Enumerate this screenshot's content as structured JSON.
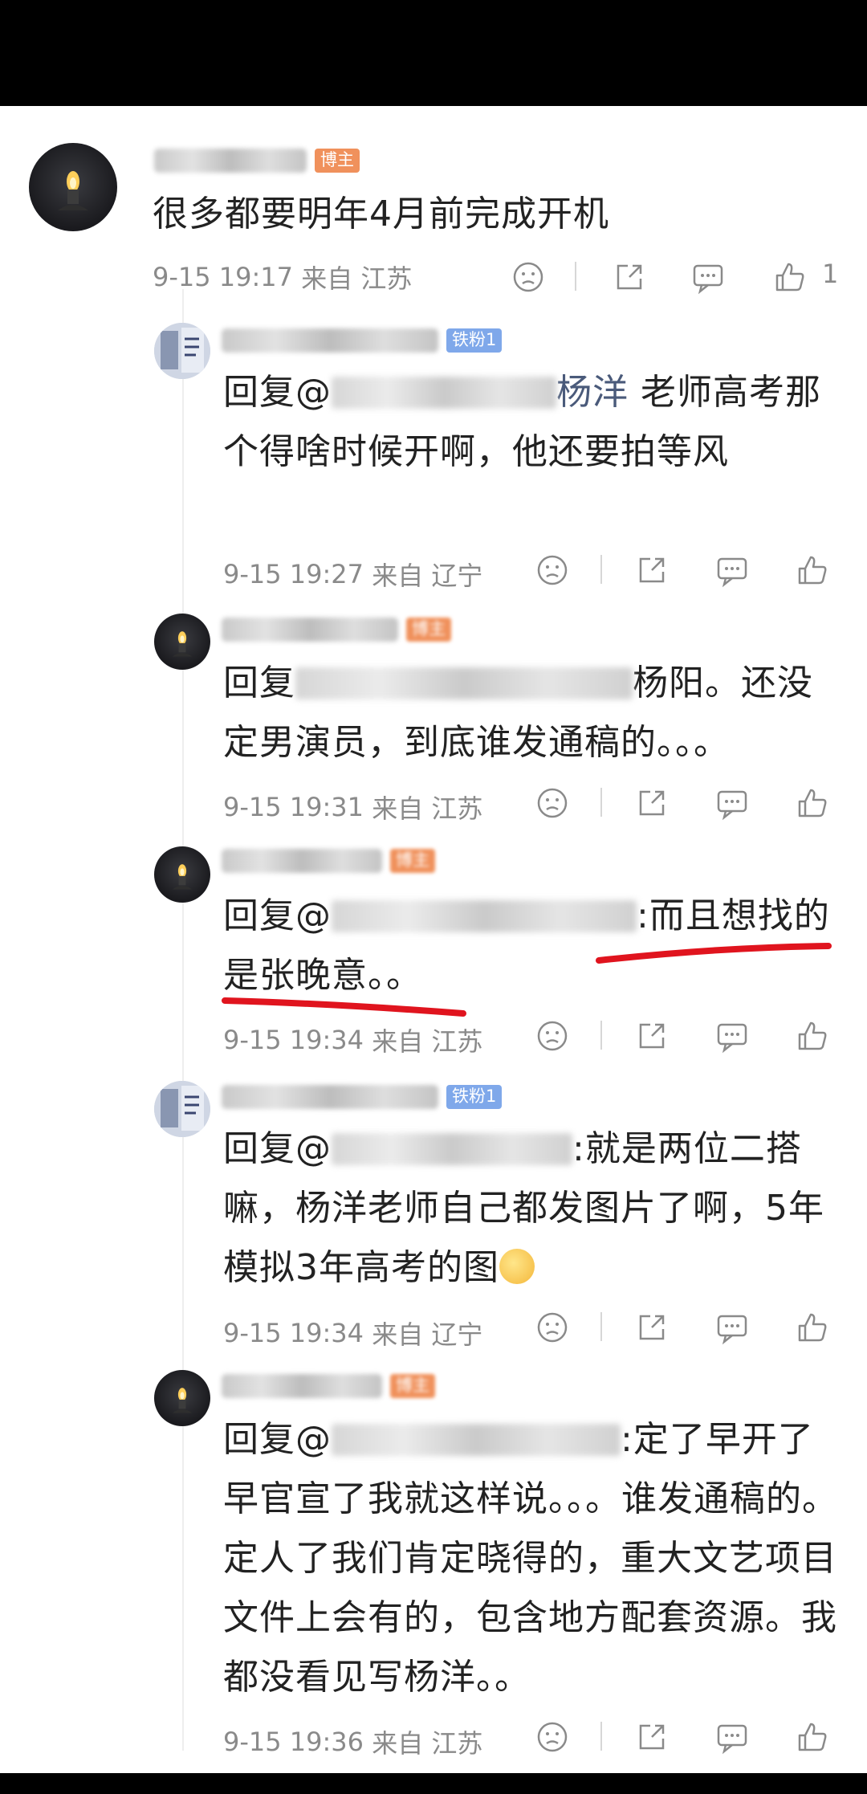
{
  "comments": [
    {
      "badge": "博主",
      "text": "很多都要明年4月前完成开机",
      "time": "9-15 19:17",
      "from": "来自",
      "location": "江苏",
      "like_count": "1"
    },
    {
      "badge": "铁粉1",
      "reply_prefix": "回复@",
      "mention": "杨洋",
      "text": "老师高考那个得啥时候开啊，他还要拍等风",
      "time": "9-15 19:27",
      "from": "来自",
      "location": "辽宁"
    },
    {
      "badge": "博主",
      "reply_prefix": "回复",
      "text": "杨阳。还没定男演员，到底谁发通稿的。。。",
      "time": "9-15 19:31",
      "from": "来自",
      "location": "江苏"
    },
    {
      "badge": "博主",
      "reply_prefix": "回复@",
      "text": ":而且想找的是张晚意。。",
      "time": "9-15 19:34",
      "from": "来自",
      "location": "江苏"
    },
    {
      "badge": "铁粉1",
      "reply_prefix": "回复@",
      "text": ":就是两位二搭嘛，杨洋老师自己都发图片了啊，5年模拟3年高考的图",
      "time": "9-15 19:34",
      "from": "来自",
      "location": "辽宁"
    },
    {
      "badge": "博主",
      "reply_prefix": "回复@",
      "text": ":定了早开了早官宣了我就这样说。。。谁发通稿的。定人了我们肯定晓得的，重大文艺项目文件上会有的，包含地方配套资源。我都没看见写杨洋。。",
      "time": "9-15 19:36",
      "from": "来自",
      "location": "江苏"
    }
  ],
  "icons": [
    "dislike-icon",
    "share-icon",
    "comment-icon",
    "like-icon"
  ],
  "colors": {
    "blogger_badge": "#f0915c",
    "fan_badge": "#7fa8ea",
    "highlight_underline": "#e0141e",
    "meta_text": "#8a8a8a"
  }
}
